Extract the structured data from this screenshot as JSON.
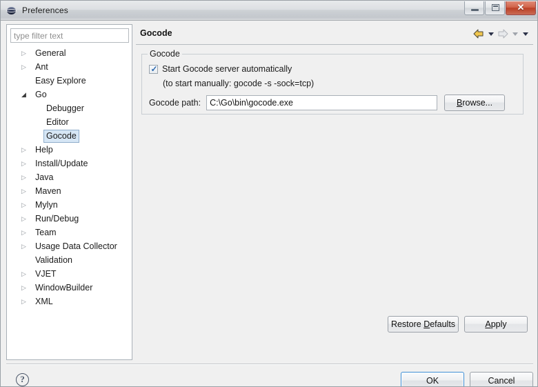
{
  "window": {
    "title": "Preferences",
    "icon": "eclipse-globe-icon",
    "controls": {
      "minimize": "minimize-button",
      "maximize": "maximize-button",
      "close": "✕"
    }
  },
  "sidebar": {
    "filter": {
      "placeholder": "type filter text",
      "value": ""
    },
    "items": [
      {
        "label": "General",
        "level": 0,
        "twisty": "collapsed",
        "selected": false
      },
      {
        "label": "Ant",
        "level": 0,
        "twisty": "collapsed",
        "selected": false
      },
      {
        "label": "Easy Explore",
        "level": 0,
        "twisty": "none",
        "selected": false
      },
      {
        "label": "Go",
        "level": 0,
        "twisty": "expanded",
        "selected": false
      },
      {
        "label": "Debugger",
        "level": 1,
        "twisty": "none",
        "selected": false
      },
      {
        "label": "Editor",
        "level": 1,
        "twisty": "none",
        "selected": false
      },
      {
        "label": "Gocode",
        "level": 1,
        "twisty": "none",
        "selected": true
      },
      {
        "label": "Help",
        "level": 0,
        "twisty": "collapsed",
        "selected": false
      },
      {
        "label": "Install/Update",
        "level": 0,
        "twisty": "collapsed",
        "selected": false
      },
      {
        "label": "Java",
        "level": 0,
        "twisty": "collapsed",
        "selected": false
      },
      {
        "label": "Maven",
        "level": 0,
        "twisty": "collapsed",
        "selected": false
      },
      {
        "label": "Mylyn",
        "level": 0,
        "twisty": "collapsed",
        "selected": false
      },
      {
        "label": "Run/Debug",
        "level": 0,
        "twisty": "collapsed",
        "selected": false
      },
      {
        "label": "Team",
        "level": 0,
        "twisty": "collapsed",
        "selected": false
      },
      {
        "label": "Usage Data Collector",
        "level": 0,
        "twisty": "collapsed",
        "selected": false
      },
      {
        "label": "Validation",
        "level": 0,
        "twisty": "none",
        "selected": false
      },
      {
        "label": "VJET",
        "level": 0,
        "twisty": "collapsed",
        "selected": false
      },
      {
        "label": "WindowBuilder",
        "level": 0,
        "twisty": "collapsed",
        "selected": false
      },
      {
        "label": "XML",
        "level": 0,
        "twisty": "collapsed",
        "selected": false
      }
    ]
  },
  "page": {
    "title": "Gocode",
    "nav": {
      "back_icon": "back-arrow-icon",
      "back_menu_icon": "chevron-down-icon",
      "forward_icon": "forward-arrow-icon",
      "forward_menu_icon": "chevron-down-icon",
      "view_menu_icon": "chevron-down-icon"
    },
    "group": {
      "legend": "Gocode",
      "checkbox": {
        "label": "Start Gocode server automatically",
        "checked": true,
        "mark": "✓"
      },
      "hint": "(to start manually: gocode -s -sock=tcp)",
      "path": {
        "label": "Gocode path:",
        "value": "C:\\Go\\bin\\gocode.exe",
        "placeholder": ""
      },
      "browse_button": {
        "prefix": "",
        "accel": "B",
        "rest": "rowse..."
      }
    },
    "buttons": {
      "restore_defaults": {
        "prefix": "Restore ",
        "accel": "D",
        "rest": "efaults"
      },
      "apply": {
        "prefix": "",
        "accel": "A",
        "rest": "pply"
      }
    }
  },
  "footer": {
    "help_icon": "?",
    "ok": "OK",
    "cancel": "Cancel"
  },
  "colors": {
    "dialog_bg": "#f0f0f0",
    "selection_fill": "#d6e6f5",
    "selection_border": "#8fadcb",
    "default_button_border": "#3d8dd4",
    "back_arrow": "#f0c64e",
    "forward_arrow": "#d8dade",
    "close_button": "#bb4026",
    "check_mark": "#2f6bb0"
  }
}
